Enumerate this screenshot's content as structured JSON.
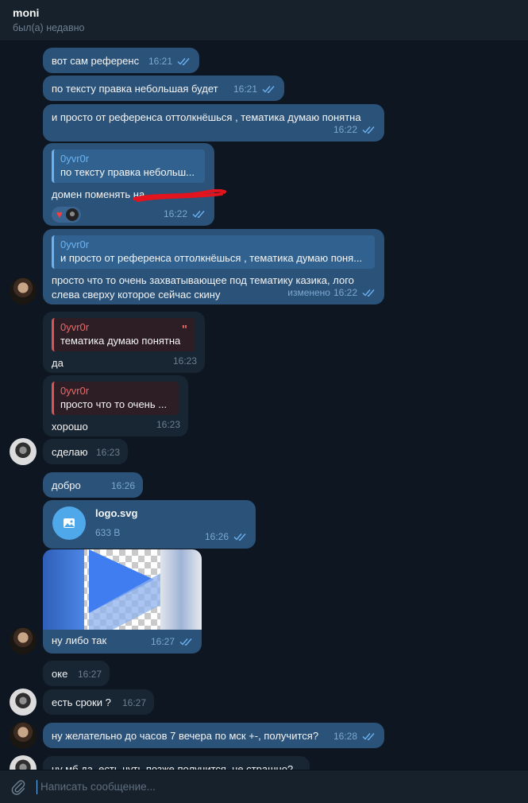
{
  "header": {
    "name": "moni",
    "status": "был(а) недавно"
  },
  "messages": [
    {
      "text": "вот сам референс",
      "time": "16:21"
    },
    {
      "text": "по тексту правка небольшая будет",
      "time": "16:21"
    },
    {
      "text": "и просто от референса оттолкнёшься , тематика думаю понятна",
      "time": "16:22"
    },
    {
      "reply_author": "0yvr0r",
      "reply_text": "по тексту правка небольш...",
      "text": "домен поменять на",
      "time": "16:22",
      "reaction": "♥"
    },
    {
      "reply_author": "0yvr0r",
      "reply_text": "и просто от референса оттолкнёшься , тематика думаю поня...",
      "text_line1": "просто что то очень захватывающее под тематику казика, лого",
      "text_line2": "слева сверху которое сейчас скину",
      "edited": "изменено",
      "time": "16:22"
    },
    {
      "reply_author": "0yvr0r",
      "reply_text": "тематика думаю понятна",
      "quote": "\"",
      "text": "да",
      "time": "16:23"
    },
    {
      "reply_author": "0yvr0r",
      "reply_text": "просто что то очень ...",
      "text": "хорошо",
      "time": "16:23"
    },
    {
      "text": "сделаю",
      "time": "16:23"
    },
    {
      "text": "добро",
      "time": "16:26"
    },
    {
      "file_name": "logo.svg",
      "file_size": "633 B",
      "time": "16:26"
    },
    {
      "text": "ну либо так",
      "time": "16:27"
    },
    {
      "text": "оке",
      "time": "16:27"
    },
    {
      "text": "есть сроки ?",
      "time": "16:27"
    },
    {
      "text": "ну желательно до часов 7 вечера по мск +-, получится?",
      "time": "16:28"
    },
    {
      "text": "ну мб да, есть чуть позже получится, не страшно?"
    }
  ],
  "composer": {
    "placeholder": "Написать сообщение..."
  },
  "colors": {
    "outgoing": "#2b5278",
    "incoming": "#182533",
    "accent": "#6ab2f2",
    "reply_incoming": "#e96a6a"
  }
}
